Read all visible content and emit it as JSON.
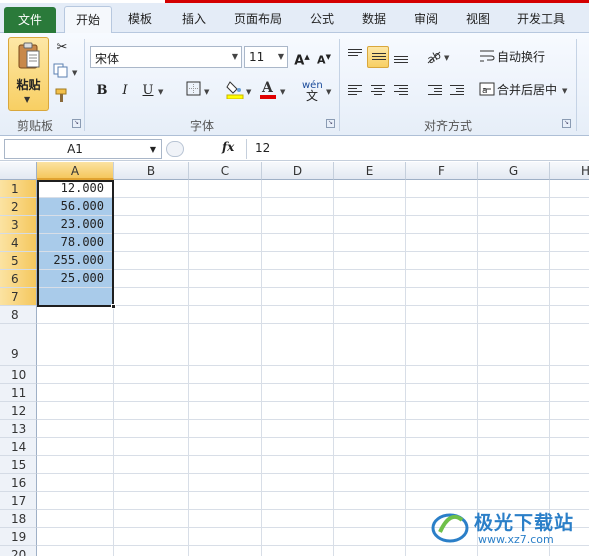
{
  "ribbon": {
    "tabs": [
      {
        "label": "文件"
      },
      {
        "label": "开始"
      },
      {
        "label": "模板"
      },
      {
        "label": "插入"
      },
      {
        "label": "页面布局"
      },
      {
        "label": "公式"
      },
      {
        "label": "数据"
      },
      {
        "label": "审阅"
      },
      {
        "label": "视图"
      },
      {
        "label": "开发工具"
      }
    ],
    "active_tab": "开始",
    "clipboard": {
      "paste_label": "粘贴",
      "group_label": "剪贴板"
    },
    "font": {
      "name": "宋体",
      "size": "11",
      "group_label": "字体",
      "highlight_color": "#ffff00",
      "font_color": "#e00000"
    },
    "alignment": {
      "group_label": "对齐方式",
      "wrap_label": "自动换行",
      "merge_label": "合并后居中"
    }
  },
  "formula_bar": {
    "name_box": "A1",
    "fx": "fx",
    "content": "12"
  },
  "grid": {
    "columns": [
      "A",
      "B",
      "C",
      "D",
      "E",
      "F",
      "G",
      "H"
    ],
    "rows": [
      "1",
      "2",
      "3",
      "4",
      "5",
      "6",
      "7",
      "8",
      "9",
      "10",
      "11",
      "12",
      "13",
      "14",
      "15",
      "16",
      "17",
      "18",
      "19",
      "20"
    ],
    "cells": {
      "A1": "12.000",
      "A2": "56.000",
      "A3": "23.000",
      "A4": "78.000",
      "A5": "255.000",
      "A6": "25.000"
    },
    "selection": "A1:A7"
  },
  "watermark": {
    "title": "极光下载站",
    "url": "www.xz7.com"
  },
  "colors": {
    "selection_fill": "#a9cbea",
    "file_tab": "#2a7a3a",
    "header_selected": "#f5c75d"
  }
}
